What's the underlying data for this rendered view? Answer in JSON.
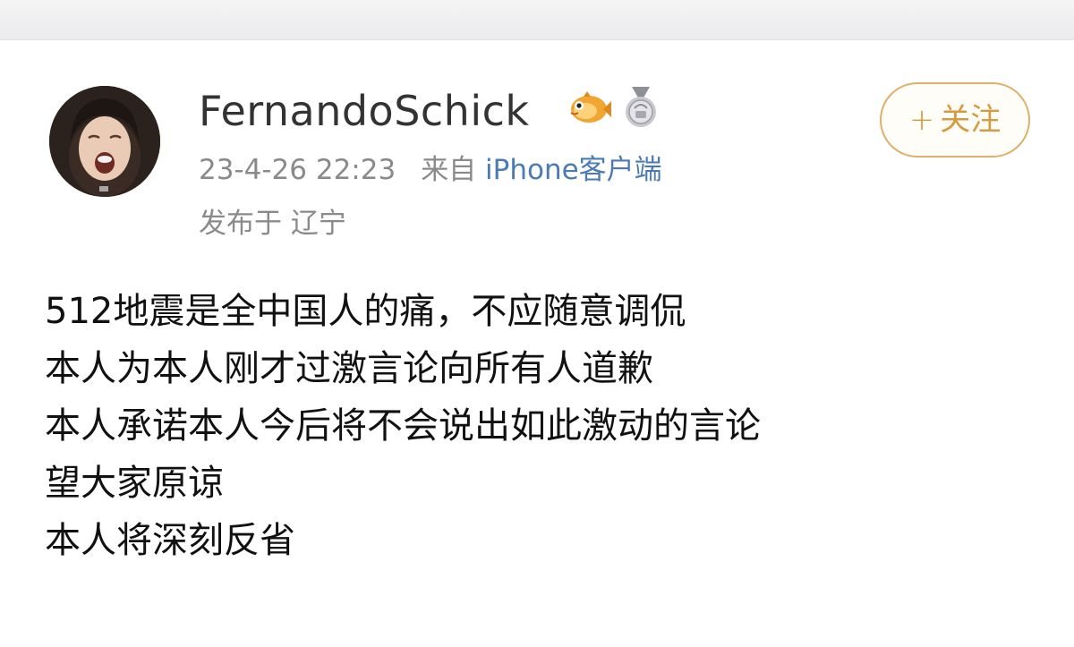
{
  "post": {
    "author": {
      "username": "FernandoSchick",
      "avatar": "user-avatar-photo",
      "badges": [
        "fish-badge-icon",
        "silver-medal-badge-icon"
      ]
    },
    "timestamp": "23-4-26 22:23",
    "source_prefix": "来自",
    "source_device": "iPhone客户端",
    "location": "发布于 辽宁",
    "follow_button": {
      "icon": "+",
      "label": "关注"
    },
    "lines": [
      "512地震是全中国人的痛，不应随意调侃",
      "本人为本人刚才过激言论向所有人道歉",
      "本人承诺本人今后将不会说出如此激动的言论",
      "望大家原谅",
      "本人将深刻反省"
    ]
  },
  "colors": {
    "follow_accent": "#d79b3f",
    "link_blue": "#4a7bb5",
    "meta_gray": "#8a8a8a"
  }
}
